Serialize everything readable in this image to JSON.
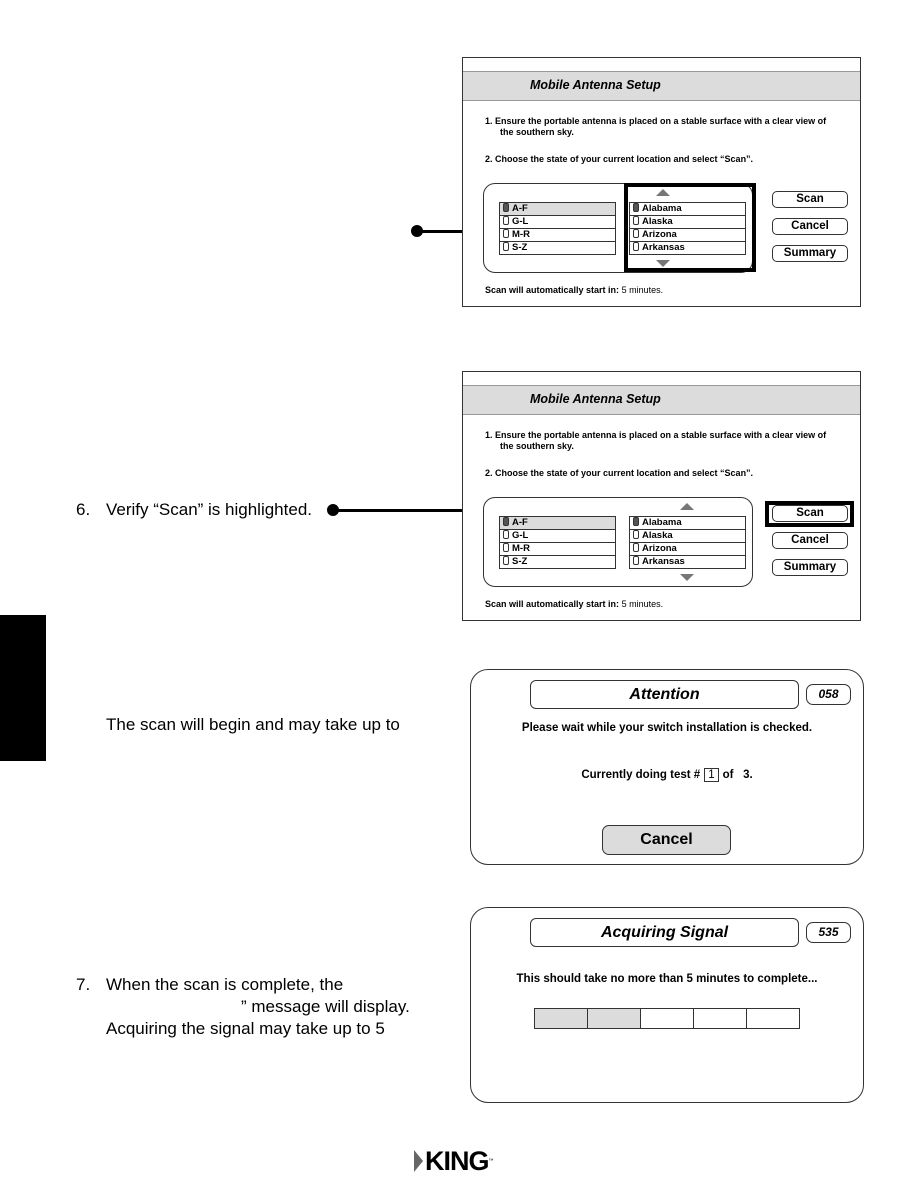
{
  "side_tab": {
    "color": "#000000"
  },
  "steps": {
    "step6": {
      "number": "6.",
      "text": "Verify “Scan” is highlighted."
    },
    "scan_note": {
      "text": "The scan will begin and may take up to"
    },
    "step7": {
      "number": "7.",
      "line1": "When the scan is complete, the",
      "line2": "” message will display.",
      "line3": "Acquiring the signal may take up to 5"
    }
  },
  "setup_screen": {
    "title": "Mobile Antenna Setup",
    "instruction1_line1": "1.  Ensure the portable antenna is placed on a stable surface with a clear view of",
    "instruction1_line2": "the southern sky.",
    "instruction2": "2.  Choose the state of your current location and select “Scan”.",
    "ranges": [
      {
        "label": "A-F",
        "selected": true
      },
      {
        "label": "G-L",
        "selected": false
      },
      {
        "label": "M-R",
        "selected": false
      },
      {
        "label": "S-Z",
        "selected": false
      }
    ],
    "states": [
      {
        "label": "Alabama",
        "selected": true
      },
      {
        "label": "Alaska",
        "selected": false
      },
      {
        "label": "Arizona",
        "selected": false
      },
      {
        "label": "Arkansas",
        "selected": false
      }
    ],
    "buttons": {
      "scan": "Scan",
      "cancel": "Cancel",
      "summary": "Summary"
    },
    "footer_label": "Scan will automatically start in:",
    "footer_value": "5 minutes."
  },
  "attention_dialog": {
    "title": "Attention",
    "code": "058",
    "message": "Please wait while your switch installation is checked.",
    "test_prefix": "Currently doing test  #",
    "test_current": "1",
    "test_of": "of",
    "test_total": "3.",
    "cancel_label": "Cancel"
  },
  "acquiring_dialog": {
    "title": "Acquiring Signal",
    "code": "535",
    "message": "This should take no more than 5 minutes to complete...",
    "progress": {
      "completed_segments": 2,
      "total_segments": 5
    }
  },
  "logo": {
    "text": "KING",
    "trademark": "™"
  }
}
